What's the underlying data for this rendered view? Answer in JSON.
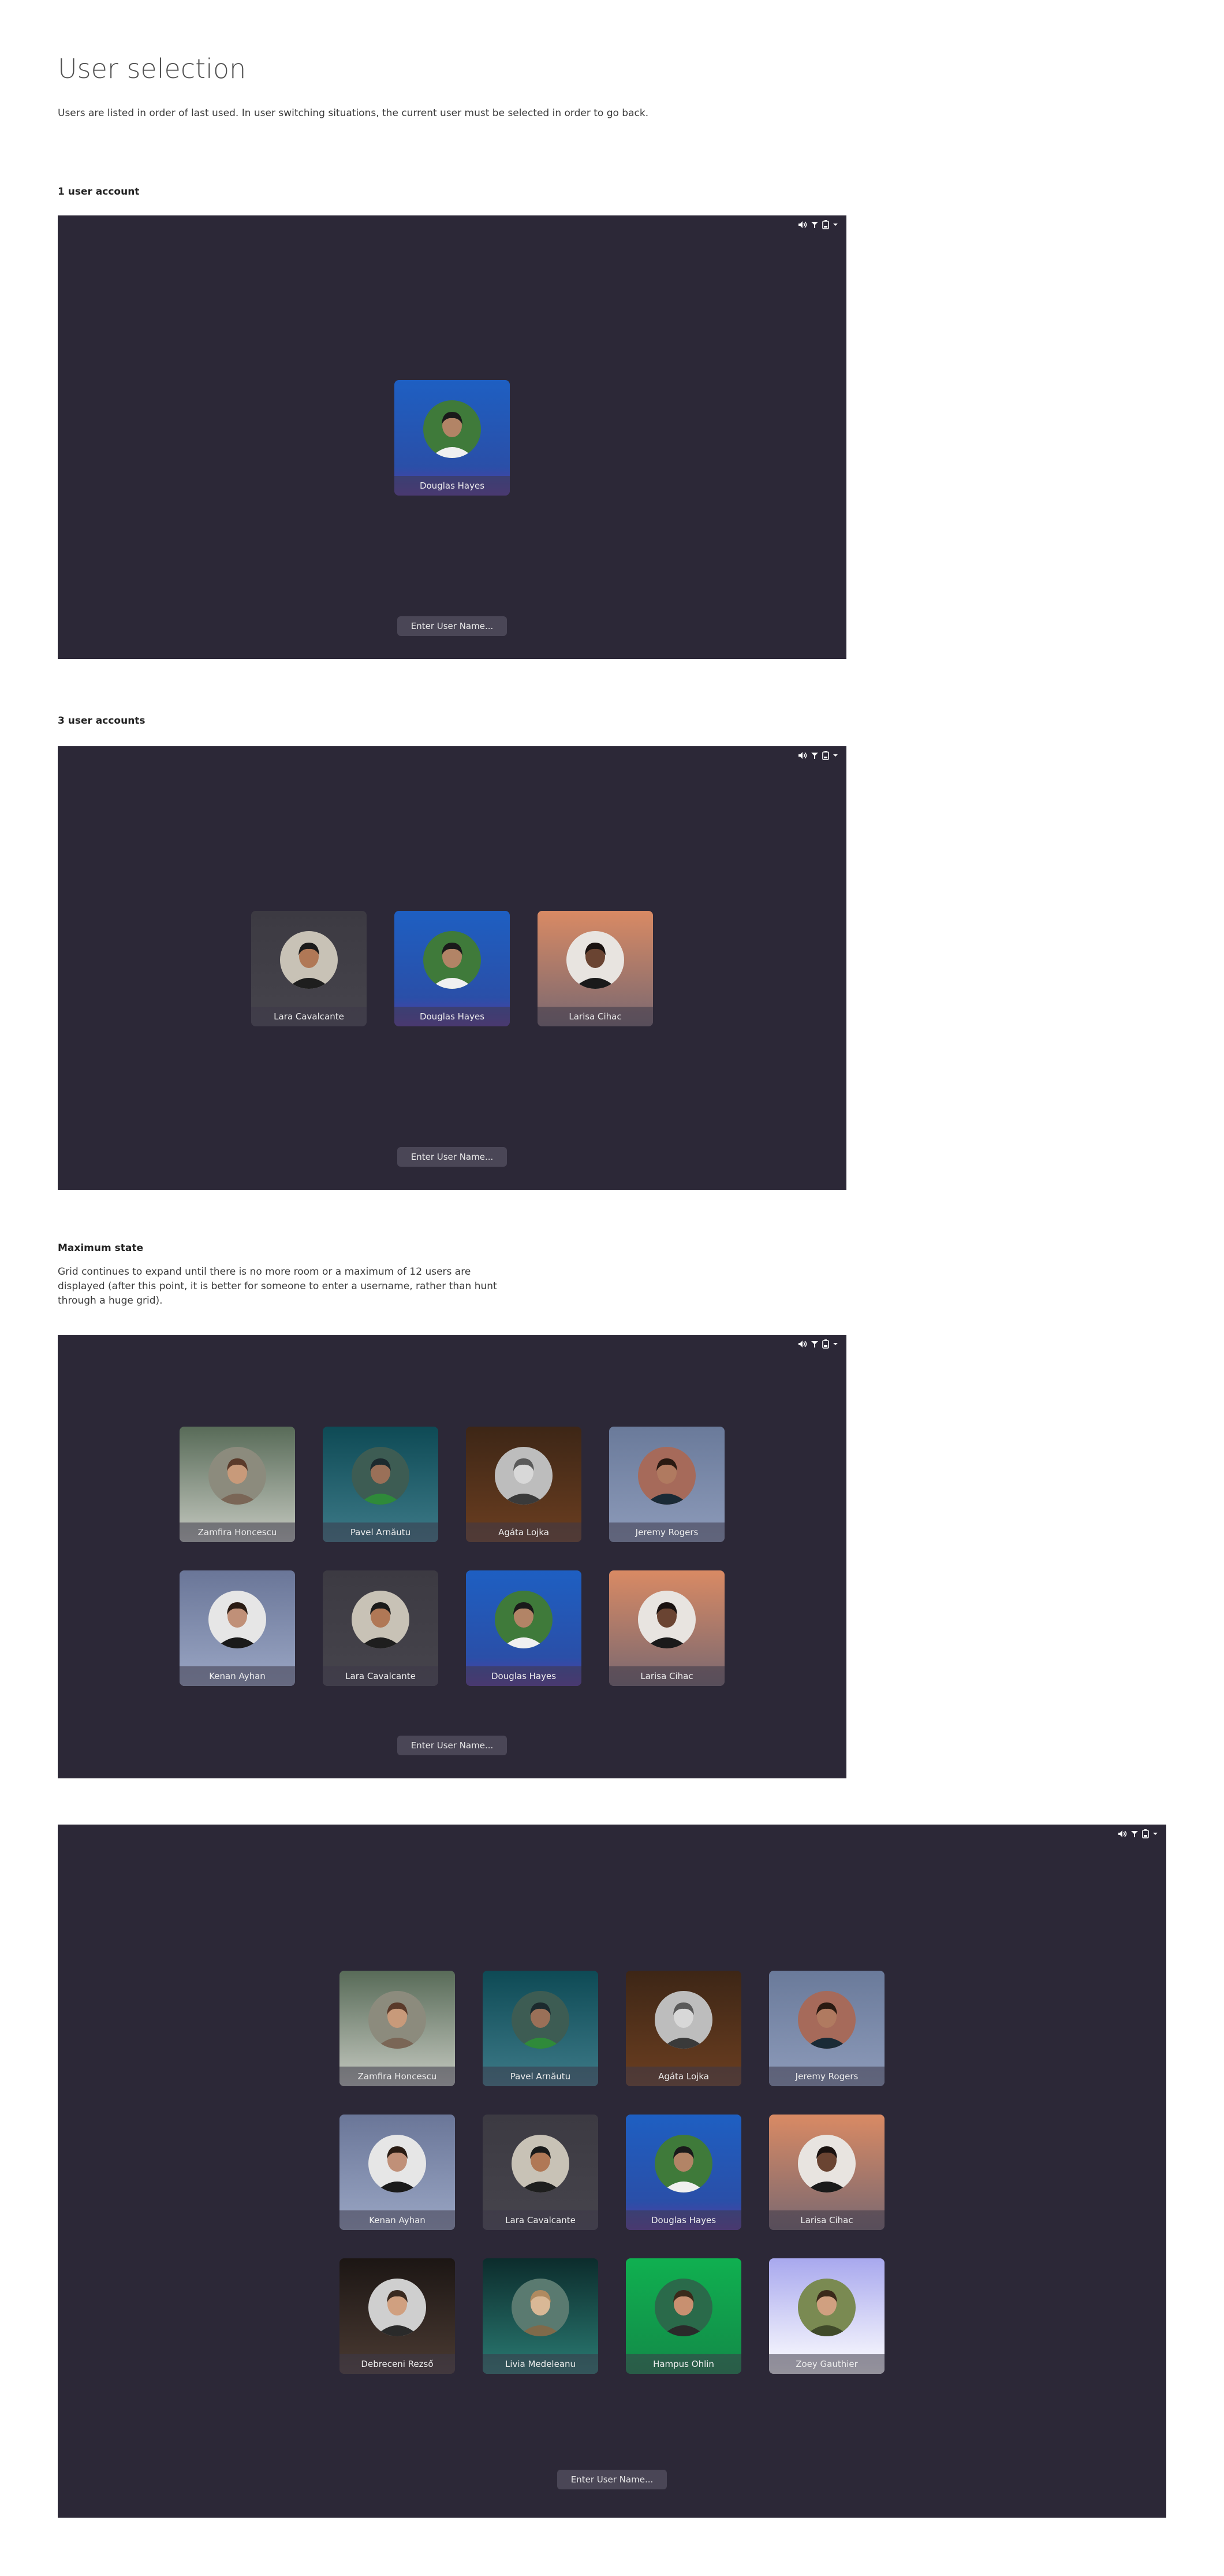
{
  "page": {
    "title": "User selection",
    "description": "Users are listed in order of last used. In user switching situations, the current user must be selected in order to go back."
  },
  "sections": [
    {
      "heading": "1 user account"
    },
    {
      "heading": "3 user accounts"
    },
    {
      "heading": "Maximum state",
      "text": "Grid continues to expand until there is no more room or a maximum of 12 users are displayed (after this point, it is better for someone to enter a username, rather than hunt through a huge grid)."
    }
  ],
  "tray_icons": [
    "volume-icon",
    "network-icon",
    "battery-icon",
    "chevron-down-icon"
  ],
  "enter_button": "Enter User Name...",
  "users": {
    "zamfira": {
      "name": "Zamfira Honcescu",
      "bg": "linear-gradient(180deg,#586b58,#c5c9c0)",
      "skin": "#c89a7a",
      "hair": "#5a3a2a",
      "shirt": "#7a6656",
      "photo": "#8c8b7d"
    },
    "pavel": {
      "name": "Pavel Arnăutu",
      "bg": "linear-gradient(180deg,#0e4a55,#3d7a88)",
      "skin": "#9a7058",
      "hair": "#1c2a2e",
      "shirt": "#2f8a3a",
      "photo": "#3d5c53"
    },
    "agata": {
      "name": "Agáta Lojka",
      "bg": "linear-gradient(180deg,#3d2616,#6b3e20)",
      "skin": "#d8d8d8",
      "hair": "#5a5a5a",
      "shirt": "#3a3a3a",
      "photo": "#bdbdbd"
    },
    "jeremy": {
      "name": "Jeremy Rogers",
      "bg": "linear-gradient(180deg,#6a7a9a,#8d9bba)",
      "skin": "#b07a60",
      "hair": "#2a1a12",
      "shirt": "#1a2a36",
      "photo": "#a66a5a"
    },
    "kenan": {
      "name": "Kenan Ayhan",
      "bg": "linear-gradient(180deg,#6a7698,#9aa6c4)",
      "skin": "#c09078",
      "hair": "#2a1c14",
      "shirt": "#1a1a1a",
      "photo": "#e6e6e6"
    },
    "lara": {
      "name": "Lara Cavalcante",
      "bg": "linear-gradient(180deg,#3c3a42,#46444c)",
      "skin": "#b07856",
      "hair": "#1a1a1a",
      "shirt": "#1e1e1e",
      "photo": "#c8c2b6"
    },
    "douglas": {
      "name": "Douglas Hayes",
      "bg": "linear-gradient(180deg,#1e5fc2,#2a4fa8 75%,#5a3aa0)",
      "skin": "#b28466",
      "hair": "#1a1a1a",
      "shirt": "#f0f0f0",
      "photo": "#3f7a3a"
    },
    "larisa": {
      "name": "Larisa Cihac",
      "bg": "linear-gradient(180deg,#d98a64,#7a6870)",
      "skin": "#6a4432",
      "hair": "#1a1210",
      "shirt": "#1a1a1a",
      "photo": "#e8e4e0"
    },
    "debreceni": {
      "name": "Debreceni Rezső",
      "bg": "linear-gradient(180deg,#1c1614,#4a3a32)",
      "skin": "#d0a080",
      "hair": "#3a2a20",
      "shirt": "#2a2a2a",
      "photo": "#cfcfcf"
    },
    "livia": {
      "name": "Livia Medeleanu",
      "bg": "linear-gradient(180deg,#0c2c2c,#2a7a72)",
      "skin": "#d9b896",
      "hair": "#b08a60",
      "shirt": "#806a4a",
      "photo": "#5a7a70"
    },
    "hampus": {
      "name": "Hampus Ohlin",
      "bg": "linear-gradient(180deg,#10b050,#128a48)",
      "skin": "#c89070",
      "hair": "#3a2a1a",
      "shirt": "#2a2a2a",
      "photo": "#2a6a4a"
    },
    "zoey": {
      "name": "Zoey Gauthier",
      "bg": "linear-gradient(180deg,#a8a8ee,#ffffff)",
      "skin": "#d0a080",
      "hair": "#3a2a1a",
      "shirt": "#404a2a",
      "photo": "#7a8a52"
    }
  },
  "screens": [
    {
      "users": [
        "douglas"
      ]
    },
    {
      "users": [
        "lara",
        "douglas",
        "larisa"
      ]
    },
    {
      "users": [
        "zamfira",
        "pavel",
        "agata",
        "jeremy",
        "kenan",
        "lara",
        "douglas",
        "larisa"
      ]
    },
    {
      "users": [
        "zamfira",
        "pavel",
        "agata",
        "jeremy",
        "kenan",
        "lara",
        "douglas",
        "larisa",
        "debreceni",
        "livia",
        "hampus",
        "zoey"
      ]
    }
  ]
}
